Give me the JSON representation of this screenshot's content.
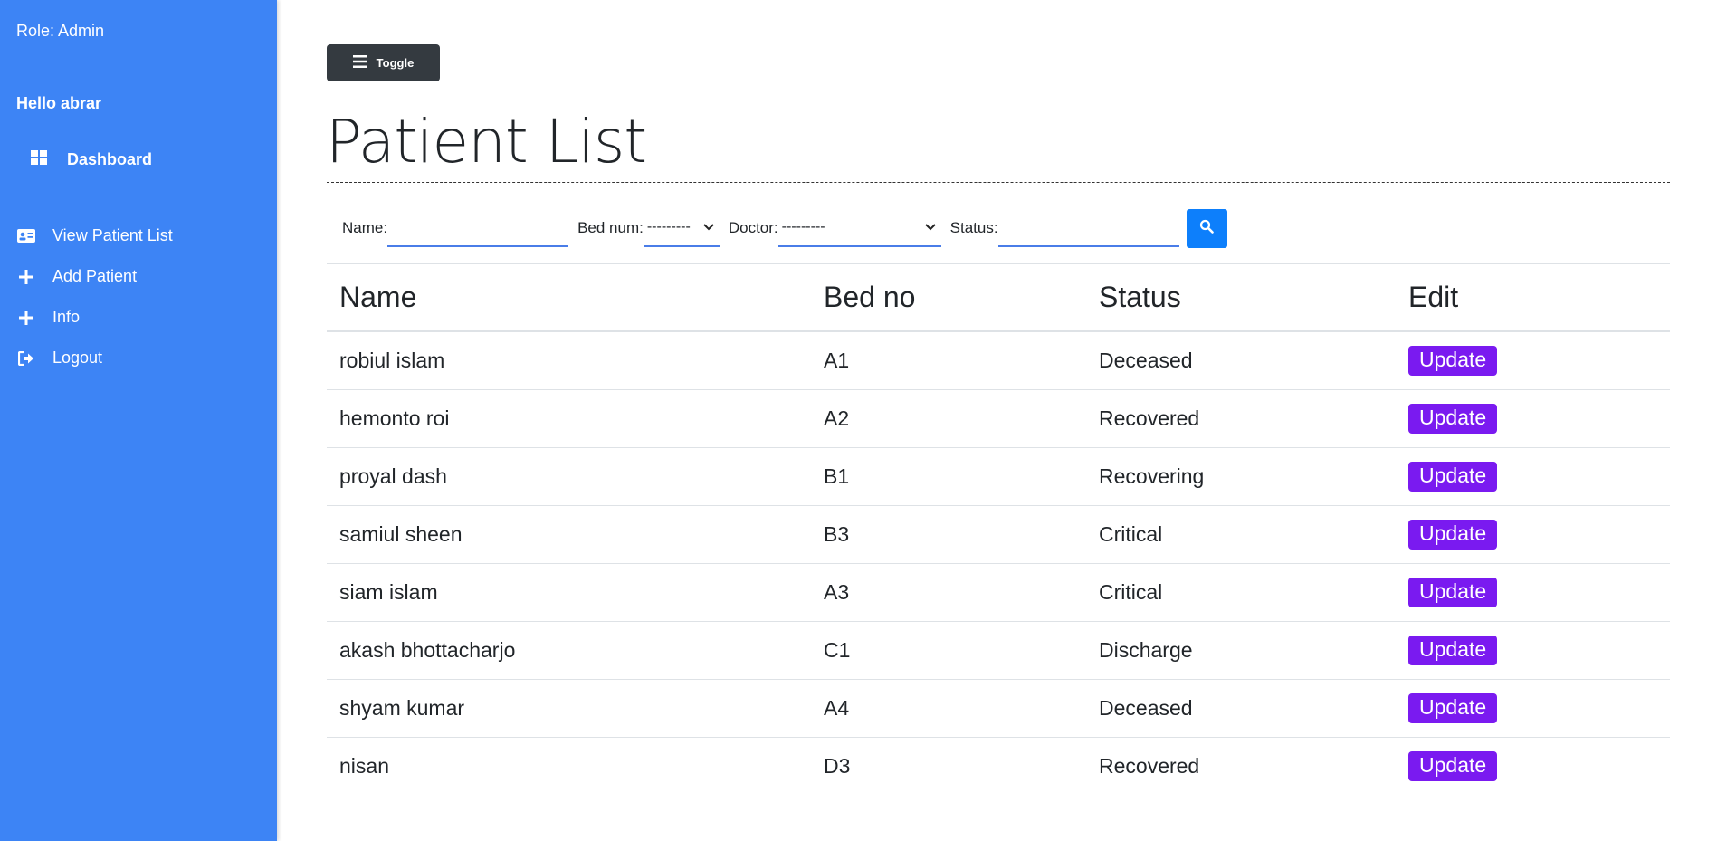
{
  "sidebar": {
    "role": "Role: Admin",
    "greeting": "Hello abrar",
    "dashboard": "Dashboard",
    "items": [
      {
        "label": "View Patient List",
        "icon": "id-card-icon"
      },
      {
        "label": "Add Patient",
        "icon": "plus-icon"
      },
      {
        "label": "Info",
        "icon": "plus-icon"
      },
      {
        "label": "Logout",
        "icon": "logout-icon"
      }
    ]
  },
  "main": {
    "toggle": "Toggle",
    "title": "Patient List",
    "filters": {
      "name_label": "Name:",
      "bed_label": "Bed num:",
      "bed_value": "---------",
      "doctor_label": "Doctor:",
      "doctor_value": "---------",
      "status_label": "Status:"
    },
    "table": {
      "headers": [
        "Name",
        "Bed no",
        "Status",
        "Edit"
      ],
      "button_label": "Update",
      "rows": [
        {
          "name": "robiul islam",
          "bed": "A1",
          "status": "Deceased"
        },
        {
          "name": "hemonto roi",
          "bed": "A2",
          "status": "Recovered"
        },
        {
          "name": "proyal dash",
          "bed": "B1",
          "status": "Recovering"
        },
        {
          "name": "samiul sheen",
          "bed": "B3",
          "status": "Critical"
        },
        {
          "name": "siam islam",
          "bed": "A3",
          "status": "Critical"
        },
        {
          "name": "akash bhottacharjo",
          "bed": "C1",
          "status": "Discharge"
        },
        {
          "name": "shyam kumar",
          "bed": "A4",
          "status": "Deceased"
        },
        {
          "name": "nisan",
          "bed": "D3",
          "status": "Recovered"
        }
      ]
    }
  },
  "colors": {
    "sidebar": "#3d84f5",
    "toggle": "#343a40",
    "search": "#0d7ffb",
    "update": "#7a1af0"
  }
}
